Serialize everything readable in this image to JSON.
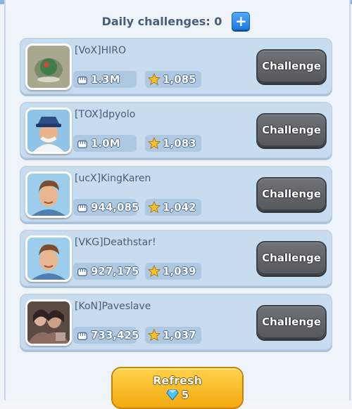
{
  "header": {
    "daily_challenges_label": "Daily challenges: 0",
    "add_icon": "plus-icon",
    "add_symbol": "+"
  },
  "players": [
    {
      "name": "[VoX]HIRO",
      "power": "1.3M",
      "trophies": "1,085",
      "challenge_label": "Challenge",
      "avatar": "green-orb-avatar"
    },
    {
      "name": "[TOX]dpyolo",
      "power": "1.0M",
      "trophies": "1,083",
      "challenge_label": "Challenge",
      "avatar": "hat-captain-avatar"
    },
    {
      "name": "[ucX]KingKaren",
      "power": "944,085",
      "trophies": "1,042",
      "challenge_label": "Challenge",
      "avatar": "hero-avatar"
    },
    {
      "name": "[VKG]Deathstar!",
      "power": "927,175",
      "trophies": "1,039",
      "challenge_label": "Challenge",
      "avatar": "hero-avatar"
    },
    {
      "name": "[KoN]Paveslave",
      "power": "733,425",
      "trophies": "1,037",
      "challenge_label": "Challenge",
      "avatar": "group-photo-avatar"
    }
  ],
  "refresh": {
    "label": "Refresh",
    "cost": "5",
    "cost_icon": "gem-icon"
  },
  "colors": {
    "card": "#c7dcef",
    "challenge_button": "#5f6368",
    "refresh_button": "#f4b41a",
    "add_button": "#2b8bf0"
  }
}
